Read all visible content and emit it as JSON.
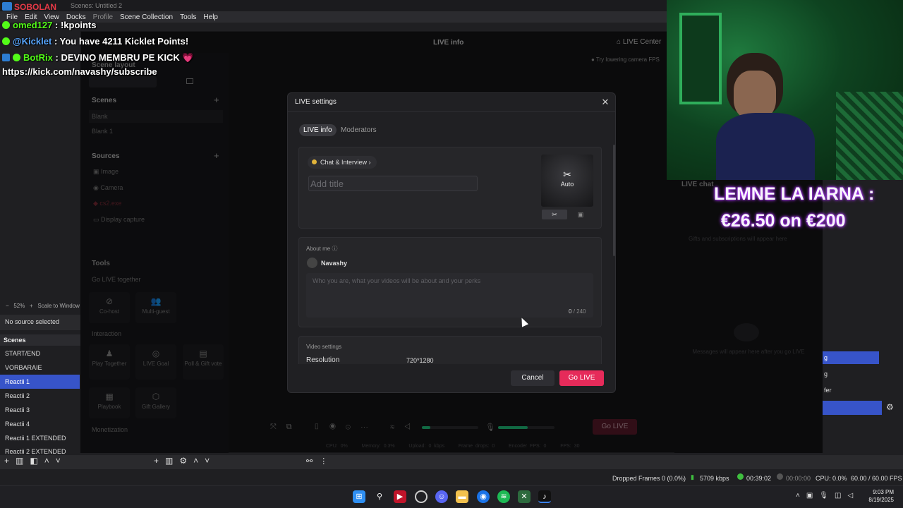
{
  "obs": {
    "title_app": "SOBOLAN",
    "title_bar": "Scenes: Untitled 2",
    "menu": [
      "File",
      "Edit",
      "View",
      "Docks",
      "Profile",
      "Scene Collection",
      "Tools",
      "Help"
    ],
    "zoom": "52%",
    "scale_label": "Scale to Window",
    "no_source": "No source selected",
    "scenes_header": "Scenes",
    "scenes": [
      "START/END",
      "VORBARAIE",
      "Reactii 1",
      "Reactii 2",
      "Reactii 3",
      "Reactii 4",
      "Reactii 1 EXTENDED",
      "Reactii 2 EXTENDED"
    ],
    "active_scene": "Reactii 1",
    "right_partial": [
      "g",
      "g",
      "fer"
    ],
    "status": {
      "dropped": "Dropped Frames 0 (0.0%)",
      "kbps": "5709 kbps",
      "live_time": "00:39:02",
      "rec_time": "00:00:00",
      "cpu": "CPU: 0.0%",
      "fps": "60.00 / 60.00 FPS"
    }
  },
  "chat_overlay": [
    {
      "user": "omed127",
      "message": ": !kpoints",
      "badge": "green"
    },
    {
      "user": "@Kicklet",
      "message": ": You have 4211 Kicklet Points!",
      "badge": "green"
    },
    {
      "user": "BotRix",
      "message": ": DEVINO MEMBRU PE KICK 💗",
      "badge": "blue"
    },
    {
      "user": "",
      "message": "https://kick.com/navashy/subscribe",
      "badge": ""
    }
  ],
  "studio": {
    "header_center": "LIVE info",
    "live_center": "LIVE Center",
    "tip": "Try lowering camera FPS",
    "scene_layout": "Scene layout",
    "scenes_label": "Scenes",
    "scenes": [
      "Blank",
      "Blank 1"
    ],
    "sources_label": "Sources",
    "sources": [
      "Image",
      "Camera",
      "cs2.exe",
      "Display capture"
    ],
    "tools_label": "Tools",
    "go_live_together": "Go LIVE together",
    "tools_row1": [
      "Co-host",
      "Multi-guest"
    ],
    "interaction": "Interaction",
    "tools_row2": [
      "Play Together",
      "LIVE Goal",
      "Poll & Gift vote"
    ],
    "tools_row3": [
      "Playbook",
      "Gift Gallery"
    ],
    "monetization": "Monetization",
    "live_chat": "LIVE chat",
    "gifts_note": "Gifts and subscriptions will appear here",
    "messages_note": "Messages will appear here after you go LIVE",
    "bottom_golive": "Go LIVE",
    "stats": [
      "CPU: 0%",
      "Memory: 0.3%",
      "Upload: 0 kbps",
      "Frame drops: 0",
      "Encoder FPS: 0",
      "FPS: 30"
    ]
  },
  "modal": {
    "title": "LIVE settings",
    "tabs": [
      "LIVE info",
      "Moderators"
    ],
    "category": "Chat & Interview",
    "title_placeholder": "Add title",
    "cover_label": "Auto",
    "about_label": "About me",
    "username": "Navashy",
    "about_placeholder": "Who you are, what your videos will be about and your perks",
    "char_count": "0",
    "char_limit": "/ 240",
    "video_settings": "Video settings",
    "resolution_label": "Resolution",
    "resolution_value": "720*1280",
    "cancel": "Cancel",
    "go_live": "Go LIVE"
  },
  "goal": {
    "line1": "LEMNE LA IARNA :",
    "line2": "€26.50 on €200"
  },
  "taskbar": {
    "time": "9:03 PM",
    "date": "8/19/2025"
  }
}
